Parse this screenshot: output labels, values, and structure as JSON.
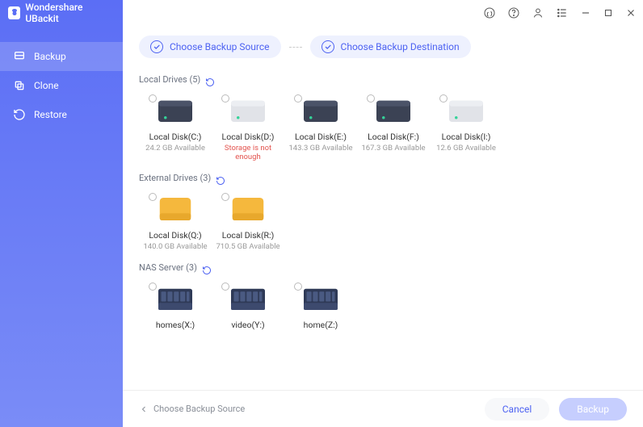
{
  "app": {
    "title": "Wondershare UBackit"
  },
  "sidebar": {
    "items": [
      {
        "label": "Backup"
      },
      {
        "label": "Clone"
      },
      {
        "label": "Restore"
      }
    ]
  },
  "steps": {
    "source": "Choose Backup Source",
    "dest": "Choose Backup Destination"
  },
  "sections": {
    "local": {
      "label": "Local Drives (5)"
    },
    "external": {
      "label": "External Drives (3)"
    },
    "nas": {
      "label": "NAS Server (3)"
    }
  },
  "local_drives": [
    {
      "name": "Local Disk(C:)",
      "sub": "24.2 GB Available",
      "err": false,
      "color": "dark"
    },
    {
      "name": "Local Disk(D:)",
      "sub": "Storage is not enough",
      "err": true,
      "color": "light"
    },
    {
      "name": "Local Disk(E:)",
      "sub": "143.3 GB Available",
      "err": false,
      "color": "dark"
    },
    {
      "name": "Local Disk(F:)",
      "sub": "167.3 GB Available",
      "err": false,
      "color": "dark"
    },
    {
      "name": "Local Disk(I:)",
      "sub": "12.6 GB Available",
      "err": false,
      "color": "light"
    }
  ],
  "external_drives": [
    {
      "name": "Local Disk(Q:)",
      "sub": "140.0 GB Available",
      "err": false
    },
    {
      "name": "Local Disk(R:)",
      "sub": "710.5 GB Available",
      "err": false
    }
  ],
  "nas_servers": [
    {
      "name": "homes(X:)"
    },
    {
      "name": "video(Y:)"
    },
    {
      "name": "home(Z:)"
    }
  ],
  "footer": {
    "source_label": "Choose Backup Source",
    "cancel": "Cancel",
    "backup": "Backup"
  }
}
